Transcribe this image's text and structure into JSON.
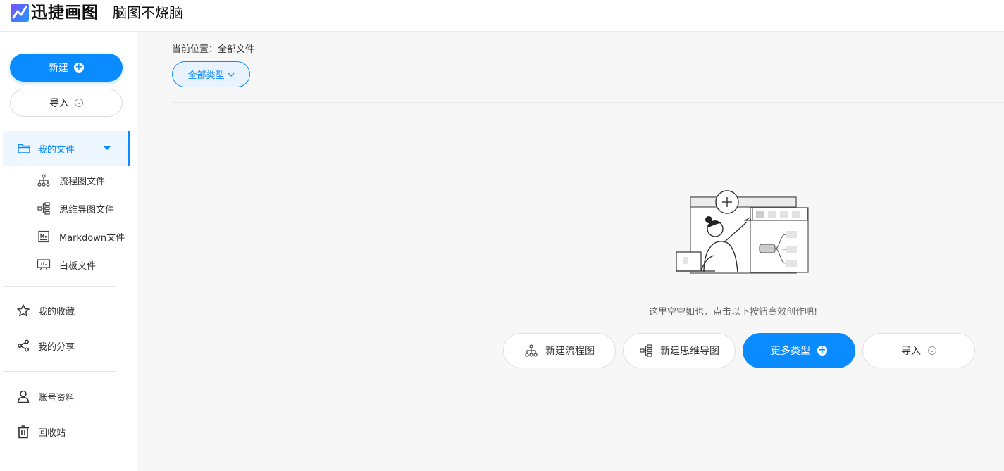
{
  "header": {
    "brand_name": "迅捷画图",
    "slogan": "脑图不烧脑"
  },
  "sidebar": {
    "new_label": "新建",
    "import_label": "导入",
    "my_files": "我的文件",
    "sub_items": [
      {
        "label": "流程图文件",
        "icon": "flowchart-icon"
      },
      {
        "label": "思维导图文件",
        "icon": "mindmap-icon"
      },
      {
        "label": "Markdown文件",
        "icon": "markdown-icon"
      },
      {
        "label": "白板文件",
        "icon": "whiteboard-icon"
      }
    ],
    "items": [
      {
        "label": "我的收藏",
        "icon": "star-icon"
      },
      {
        "label": "我的分享",
        "icon": "share-icon"
      },
      {
        "label": "账号资料",
        "icon": "user-icon"
      },
      {
        "label": "回收站",
        "icon": "trash-icon"
      }
    ]
  },
  "main": {
    "breadcrumb": "当前位置：全部文件",
    "filter_label": "全部类型",
    "empty_text": "这里空空如也，点击以下按钮高效创作吧!",
    "actions": {
      "new_flowchart": "新建流程图",
      "new_mindmap": "新建思维导图",
      "more_types": "更多类型",
      "import": "导入"
    }
  },
  "colors": {
    "accent": "#0a8bff",
    "active_bg": "#eef6ff",
    "page_bg": "#f7f7f7"
  }
}
